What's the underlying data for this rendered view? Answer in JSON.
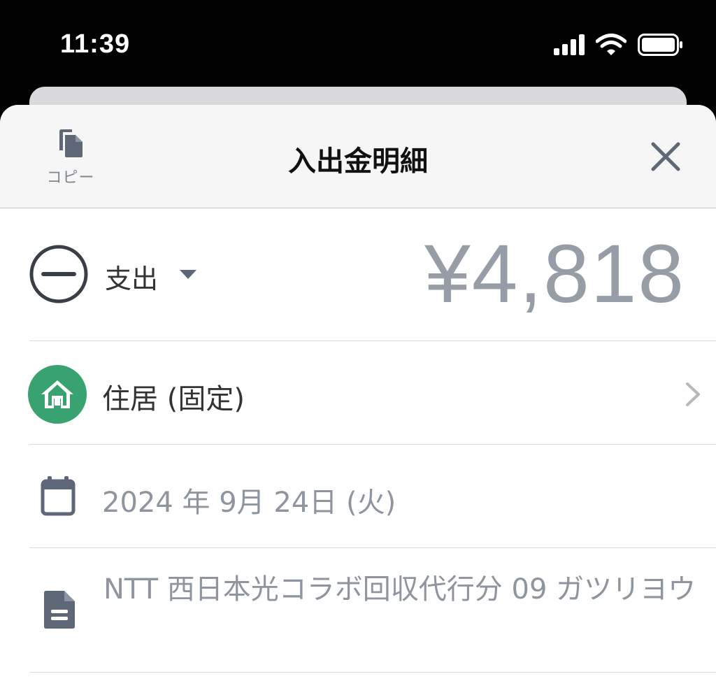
{
  "status": {
    "time": "11:39",
    "icons": [
      "cellular-signal-icon",
      "wifi-icon",
      "battery-icon"
    ]
  },
  "header": {
    "copy_label": "コピー",
    "title": "入出金明細",
    "copy_icon": "copy-document-icon",
    "close_icon": "close-icon"
  },
  "transaction": {
    "type_label": "支出",
    "type_icon": "minus-circle-icon",
    "amount": "¥4,818",
    "category": "住居 (固定)",
    "category_icon": "house-icon",
    "date": "2024 年 9月 24日 (火)",
    "date_icon": "calendar-icon",
    "memo": "NTT 西日本光コラボ回収代行分 09 ガツリヨウ",
    "memo_icon": "document-icon"
  },
  "colors": {
    "category_green": "#38a271",
    "amount_gray": "#969da7",
    "icon_slate": "#5e6777"
  }
}
